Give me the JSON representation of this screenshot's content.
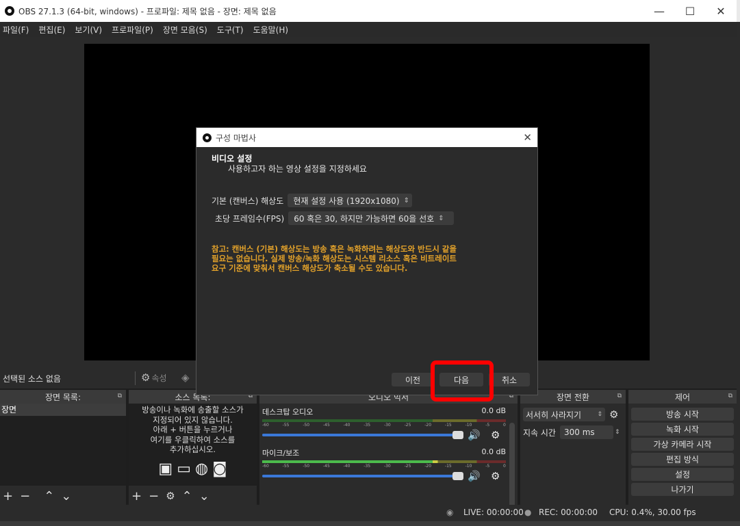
{
  "window": {
    "title": "OBS 27.1.3 (64-bit, windows) - 프로파일: 제목 없음 - 장면: 제목 없음",
    "min_icon": "—",
    "max_icon": "☐",
    "close_icon": "✕"
  },
  "menu": [
    "파일(F)",
    "편집(E)",
    "보기(V)",
    "프로파일(P)",
    "장면 모음(S)",
    "도구(T)",
    "도움말(H)"
  ],
  "source_toolbar": {
    "no_source": "선택된 소스 없음",
    "properties": "속성"
  },
  "docks": {
    "scenes": {
      "title": "장면 목록:",
      "items": [
        "장면"
      ]
    },
    "sources": {
      "title": "소스 목록:",
      "empty_text_lines": [
        "방송이나 녹화에 송출할 소스가",
        "지정되어 있지 않습니다.",
        "아래 + 버튼을 누르거나",
        "여기를 우클릭하여 소스를",
        "추가하십시오."
      ]
    },
    "mixer": {
      "title": "오디오 믹서",
      "tracks": [
        {
          "name": "데스크탑 오디오",
          "db": "0.0 dB"
        },
        {
          "name": "마이크/보조",
          "db": "0.0 dB"
        }
      ],
      "ticks": [
        "-60",
        "-55",
        "-50",
        "-45",
        "-40",
        "-35",
        "-30",
        "-25",
        "-20",
        "-15",
        "-10",
        "-5",
        "0"
      ]
    },
    "transitions": {
      "title": "장면 전환",
      "transition": "서서히 사라지기",
      "duration_label": "지속 시간",
      "duration_value": "300 ms"
    },
    "controls": {
      "title": "제어",
      "buttons": [
        "방송 시작",
        "녹화 시작",
        "가상 카메라 시작",
        "편집 방식",
        "설정",
        "나가기"
      ]
    }
  },
  "statusbar": {
    "live": "LIVE: 00:00:00",
    "rec": "REC: 00:00:00",
    "cpu": "CPU: 0.4%, 30.00 fps"
  },
  "dialog": {
    "title": "구성 마법사",
    "heading": "비디오 설정",
    "subheading": "사용하고자 하는 영상 설정을 지정하세요",
    "base_res_label": "기본 (캔버스) 해상도",
    "base_res_value": "현재 설정 사용 (1920x1080)",
    "fps_label": "초당 프레임수(FPS)",
    "fps_value": "60 혹은 30, 하지만 가능하면 60을 선호",
    "note_lines": [
      "참고: 캔버스 (기본) 해상도는 방송 혹은 녹화하려는 해상도와 반드시 같을",
      "필요는 없습니다. 실제 방송/녹화 해상도는 시스템 리소스 혹은 비트레이트",
      "요구 기준에 맞춰서 캔버스 해상도가 축소될 수도 있습니다."
    ],
    "back_button": "이전",
    "next_button": "다음",
    "cancel_button": "취소"
  },
  "colors": {
    "note": "#e3a22a",
    "highlight": "#ff0000",
    "fader": "#3a78d8"
  }
}
